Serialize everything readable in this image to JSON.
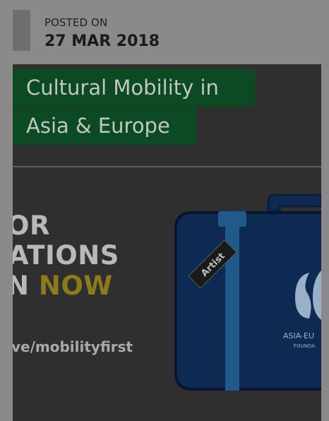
{
  "post_meta": {
    "posted_on_label": "POSTED ON",
    "posted_date": "27 MAR 2018"
  },
  "featured_image": {
    "title_line_1": "Cultural Mobility in",
    "title_line_2": "Asia & Europe",
    "banner_line_1": "OR",
    "banner_line_2": "ATIONS",
    "banner_line_3_prefix": "N ",
    "banner_line_3_emphasis": "NOW",
    "link_text": "ve/mobilityfirst",
    "tag_text": "Artist",
    "logo_text_1": "ASIA-EU",
    "logo_text_2": "FOUNDA"
  },
  "colors": {
    "page_background": "#8a8a8a",
    "title_background": "#0c4a24",
    "suitcase": "#0f2a52",
    "suitcase_accent": "#1e5a8a",
    "now_accent": "#8c7a1c"
  }
}
